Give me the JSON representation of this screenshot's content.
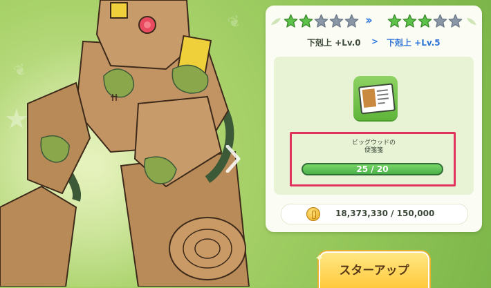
{
  "stars": {
    "from": {
      "filled": 2,
      "total": 5
    },
    "to": {
      "filled": 3,
      "total": 5
    },
    "filled_color": "#5cc24a",
    "empty_color": "#8a97a6"
  },
  "levels": {
    "from": "下剋上 +Lv.0",
    "arrow": ">",
    "to": "下剋上 +Lv.5"
  },
  "item": {
    "name_line1": "ビッグウッドの",
    "name_line2": "便箋箋",
    "progress_text": "25 / 20",
    "progress_fraction": 1.0
  },
  "currency": {
    "icon": "coin-icon",
    "text": "18,373,330 / 150,000"
  },
  "button": {
    "label": "スターアップ"
  },
  "colors": {
    "highlight": "#e2335e",
    "accent_blue": "#2f73d6",
    "progress_green": "#4bb148",
    "button_yellow": "#ffc93d"
  }
}
